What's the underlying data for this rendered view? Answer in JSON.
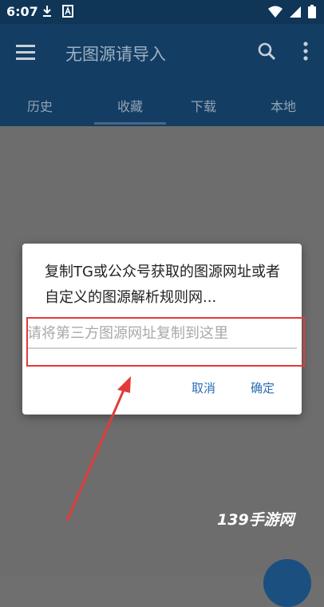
{
  "status_bar": {
    "time": "6:07",
    "icons_left": [
      "download-icon",
      "a-badge-icon"
    ],
    "icons_right": [
      "wifi-icon",
      "signal-icon",
      "battery-icon"
    ]
  },
  "app_bar": {
    "title": "无图源请导入",
    "icons": [
      "menu-icon",
      "search-icon",
      "more-vert-icon"
    ]
  },
  "tabs": [
    {
      "label": "历史"
    },
    {
      "label": "收藏",
      "selected": true
    },
    {
      "label": "下载"
    },
    {
      "label": "本地"
    }
  ],
  "dialog": {
    "message": "复制TG或公众号获取的图源网址或者自定义的图源解析规则网...",
    "input": {
      "value": "",
      "placeholder": "请将第三方图源网址复制到这里"
    },
    "cancel_label": "取消",
    "ok_label": "确定"
  },
  "watermark": "139手游网",
  "colors": {
    "app_bar": "#133d63",
    "status_bar": "#0f3557",
    "scrim": "#6d6d6d",
    "accent": "#2a6cb3",
    "annotation": "#e23a3a"
  }
}
